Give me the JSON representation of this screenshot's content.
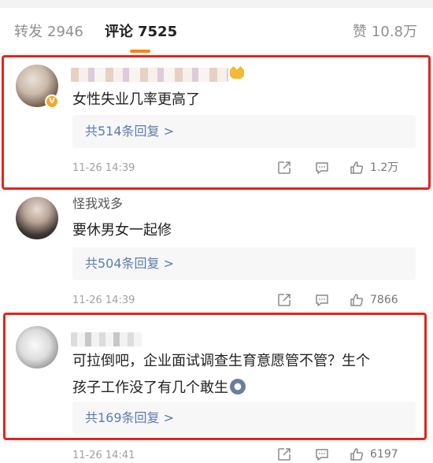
{
  "tabs": {
    "repost": {
      "label": "转发",
      "count": "2946"
    },
    "comments": {
      "label": "评论",
      "count": "7525"
    },
    "likes": {
      "label": "赞",
      "count": "10.8万"
    },
    "active_color": "#ff8200"
  },
  "comments": [
    {
      "username": "",
      "username_blurred": true,
      "verified_badge": "V",
      "text": "女性失业几率更高了",
      "replies_link": "共514条回复 >",
      "timestamp": "11-26 14:39",
      "likes": "1.2万",
      "highlighted": true
    },
    {
      "username": "怪我戏多",
      "username_blurred": false,
      "text": "要休男女一起修",
      "replies_link": "共504条回复 >",
      "timestamp": "11-26 14:39",
      "likes": "7866",
      "highlighted": false
    },
    {
      "username": "",
      "username_blurred": true,
      "text_line1": "可拉倒吧，企业面试调查生育意愿管不管？生个",
      "text_line2": "孩子工作没了有几个敢生",
      "replies_link": "共169条回复 >",
      "timestamp": "11-26 14:41",
      "likes": "6197",
      "highlighted": true
    }
  ],
  "icons": [
    "share-icon",
    "reply-icon",
    "like-icon",
    "crown-icon",
    "emoji-icon"
  ],
  "colors": {
    "highlight_border": "#e8221b",
    "link": "#5b7caf",
    "verified_badge": "#f5a623"
  }
}
